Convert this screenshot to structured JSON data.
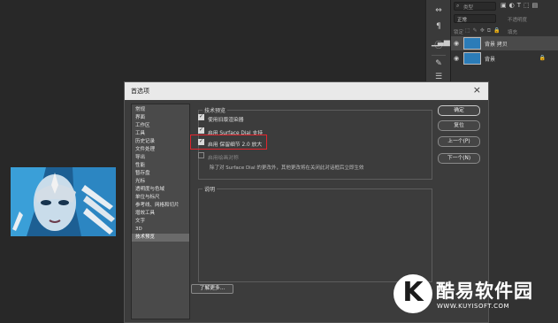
{
  "layers_panel": {
    "search_text": "类型",
    "blend_mode": "正常",
    "opacity_label": "不透明度",
    "lock_label": "锁定",
    "fill_label": "填充",
    "layers": [
      {
        "name": "背景 拷贝",
        "selected": true,
        "locked": false
      },
      {
        "name": "背景",
        "selected": false,
        "locked": true
      }
    ]
  },
  "toolstrip": {
    "icons": [
      "arrows-icon",
      "paragraph-icon",
      "levels-icon",
      "info-icon",
      "brush-icon",
      "sliders-icon"
    ]
  },
  "dialog": {
    "title": "首选项",
    "close_glyph": "×",
    "nav_items": [
      {
        "label": "常规",
        "active": false
      },
      {
        "label": "界面",
        "active": false
      },
      {
        "label": "工作区",
        "active": false
      },
      {
        "label": "工具",
        "active": false
      },
      {
        "label": "历史记录",
        "active": false
      },
      {
        "label": "文件处理",
        "active": false
      },
      {
        "label": "导出",
        "active": false
      },
      {
        "label": "性能",
        "active": false
      },
      {
        "label": "暂存盘",
        "active": false
      },
      {
        "label": "光标",
        "active": false
      },
      {
        "label": "透明度与色域",
        "active": false
      },
      {
        "label": "单位与标尺",
        "active": false
      },
      {
        "label": "参考线、网格和切片",
        "active": false
      },
      {
        "label": "增效工具",
        "active": false
      },
      {
        "label": "文字",
        "active": false
      },
      {
        "label": "3D",
        "active": false
      },
      {
        "label": "技术预览",
        "active": true
      }
    ],
    "tech_group_label": "技术预览",
    "options": [
      {
        "label": "使用旧版渲染器",
        "checked": true
      },
      {
        "label": "启用 Surface Dial 支持",
        "checked": true
      },
      {
        "label": "启用 保留细节 2.0 放大",
        "checked": true
      },
      {
        "label": "启用绘画对称",
        "checked": false
      }
    ],
    "note": "除了对 Surface Dial 的更改外，其他更改将在关闭此对话框后立即生效",
    "desc_label": "说明",
    "learn_more": "了解更多...",
    "buttons": {
      "ok": "确定",
      "reset": "复位",
      "prev": "上一个(P)",
      "next": "下一个(N)"
    }
  },
  "watermark": {
    "logo_letter": "K",
    "name": "酷易软件园",
    "url": "WWW.KUYISOFT.COM"
  },
  "colors": {
    "app_bg": "#282828",
    "dialog_bg": "#3c3c3c",
    "highlight": "#e2262e"
  }
}
